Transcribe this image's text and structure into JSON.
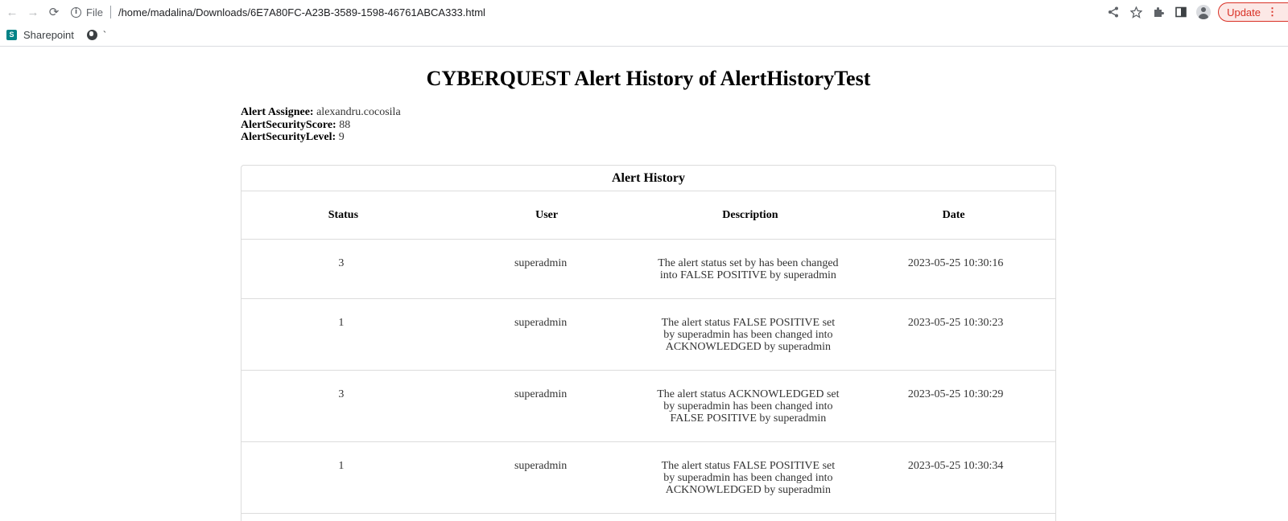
{
  "browser": {
    "back": "←",
    "forward": "→",
    "reload": "⟳",
    "scheme": "File",
    "url": "/home/madalina/Downloads/6E7A80FC-A23B-3589-1598-46761ABCA333.html",
    "update_label": "Update",
    "update_more": "⋮",
    "icons": [
      "share-icon",
      "star-icon",
      "extensions-icon",
      "side-panel-icon",
      "profile-icon"
    ]
  },
  "bookmarks": {
    "items": [
      {
        "label": "Sharepoint",
        "icon": "sharepoint-icon"
      },
      {
        "label": "`",
        "icon": "globe-icon"
      }
    ]
  },
  "page": {
    "title": "CYBERQUEST Alert History of AlertHistoryTest",
    "meta": [
      {
        "label": "Alert Assignee:",
        "value": "alexandru.cocosila"
      },
      {
        "label": "AlertSecurityScore:",
        "value": "88"
      },
      {
        "label": "AlertSecurityLevel:",
        "value": "9"
      }
    ],
    "table": {
      "caption": "Alert History",
      "columns": [
        "Status",
        "User",
        "Description",
        "Date"
      ],
      "rows": [
        {
          "status": "3",
          "user": "superadmin",
          "description": "The alert status set by has been changed into FALSE POSITIVE by superadmin",
          "date": "2023-05-25 10:30:16"
        },
        {
          "status": "1",
          "user": "superadmin",
          "description": "The alert status FALSE POSITIVE set by superadmin has been changed into ACKNOWLEDGED by superadmin",
          "date": "2023-05-25 10:30:23"
        },
        {
          "status": "3",
          "user": "superadmin",
          "description": "The alert status ACKNOWLEDGED set by superadmin has been changed into FALSE POSITIVE by superadmin",
          "date": "2023-05-25 10:30:29"
        },
        {
          "status": "1",
          "user": "superadmin",
          "description": "The alert status FALSE POSITIVE set by superadmin has been changed into ACKNOWLEDGED by superadmin",
          "date": "2023-05-25 10:30:34"
        }
      ]
    }
  }
}
